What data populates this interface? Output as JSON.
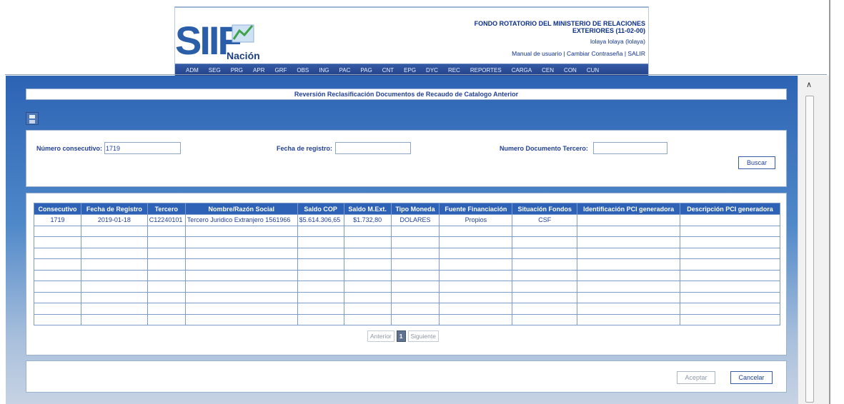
{
  "header": {
    "logo_text": "SIIF Nación",
    "entity_line1": "FONDO ROTATORIO DEL MINISTERIO DE RELACIONES",
    "entity_line2": "EXTERIORES (11-02-00)",
    "user": "lolaya lolaya (lolaya)",
    "link_manual": "Manual de usuario",
    "link_password": "Cambiar Contraseña",
    "link_exit": "SALIR",
    "separator": "|"
  },
  "menu": [
    "ADM",
    "SEG",
    "PRG",
    "APR",
    "GRF",
    "OBS",
    "ING",
    "PAC",
    "PAG",
    "CNT",
    "EPG",
    "DYC",
    "REC",
    "REPORTES",
    "CARGA",
    "CEN",
    "CON",
    "CUN"
  ],
  "page": {
    "title": "Reversión Reclasificación Documentos de Recaudo de Catalogo Anterior",
    "save_icon": "save-icon"
  },
  "search": {
    "consecutive_label": "Número consecutivo:",
    "consecutive_value": "1719",
    "date_label": "Fecha de registro:",
    "date_value": "",
    "third_doc_label": "Numero Documento Tercero:",
    "third_doc_value": "",
    "search_button": "Buscar"
  },
  "table": {
    "headers": [
      "Consecutivo",
      "Fecha de Registro",
      "Tercero",
      "Nombre/Razón Social",
      "Saldo COP",
      "Saldo M.Ext.",
      "Tipo Moneda",
      "Fuente Financiación",
      "Situación Fondos",
      "Identificación PCI generadora",
      "Descripción PCI generadora"
    ],
    "rows": [
      [
        "1719",
        "2019-01-18",
        "C12240101",
        "Tercero Juridico Extranjero 1561966",
        "$5.614.306,65",
        "$1.732,80",
        "DOLARES",
        "Propios",
        "CSF",
        "",
        ""
      ],
      [
        "",
        "",
        "",
        "",
        "",
        "",
        "",
        "",
        "",
        "",
        ""
      ],
      [
        "",
        "",
        "",
        "",
        "",
        "",
        "",
        "",
        "",
        "",
        ""
      ],
      [
        "",
        "",
        "",
        "",
        "",
        "",
        "",
        "",
        "",
        "",
        ""
      ],
      [
        "",
        "",
        "",
        "",
        "",
        "",
        "",
        "",
        "",
        "",
        ""
      ],
      [
        "",
        "",
        "",
        "",
        "",
        "",
        "",
        "",
        "",
        "",
        ""
      ],
      [
        "",
        "",
        "",
        "",
        "",
        "",
        "",
        "",
        "",
        "",
        ""
      ],
      [
        "",
        "",
        "",
        "",
        "",
        "",
        "",
        "",
        "",
        "",
        ""
      ],
      [
        "",
        "",
        "",
        "",
        "",
        "",
        "",
        "",
        "",
        "",
        ""
      ],
      [
        "",
        "",
        "",
        "",
        "",
        "",
        "",
        "",
        "",
        "",
        ""
      ]
    ]
  },
  "pager": {
    "prev": "Anterior",
    "current": "1",
    "next": "Siguiente"
  },
  "actions": {
    "accept": "Aceptar",
    "cancel": "Cancelar"
  },
  "colors": {
    "accent": "#2d62b6",
    "text": "#21409a"
  }
}
